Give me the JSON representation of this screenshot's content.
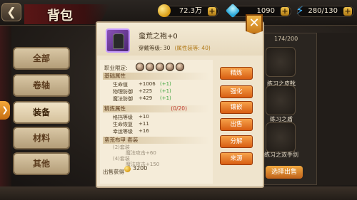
{
  "header": {
    "title": "背包",
    "gold": "72.3万",
    "gems": "1090",
    "energy": "280/130"
  },
  "tabs": [
    "全部",
    "卷轴",
    "装备",
    "材料",
    "其他"
  ],
  "active_tab": "装备",
  "inventory": {
    "count": "174/200",
    "items": [
      "练习之皮靴",
      "练习之盾",
      "练习之双手剑"
    ],
    "filter_button": "选择出售"
  },
  "item": {
    "name": "蛮荒之袍+0",
    "level_label": "穿戴等级: 30",
    "attr_note": "(属性装等: 40)",
    "class_label": "职业限定:",
    "sections": {
      "base": "基础属性",
      "refine": "精炼属性",
      "refine_count": "(0/20)",
      "set": "蛮荒布甲 套装"
    },
    "base_stats": [
      {
        "name": "生命值",
        "value": "+1006",
        "bonus": "(+1)"
      },
      {
        "name": "物理防御",
        "value": "+225",
        "bonus": "(+1)"
      },
      {
        "name": "魔法防御",
        "value": "+429",
        "bonus": "(+1)"
      }
    ],
    "refine_stats": [
      {
        "name": "格挡等级",
        "value": "+10"
      },
      {
        "name": "生命恢复",
        "value": "+11"
      },
      {
        "name": "幸运等级",
        "value": "+16"
      }
    ],
    "set_lines": [
      "(2)套装",
      "魔法攻击+60",
      "(4)套装",
      "魔法攻击+150"
    ],
    "sell_label": "出售获得",
    "sell_value": "3200"
  },
  "actions": [
    "精炼",
    "强化",
    "镶嵌",
    "出售",
    "分解",
    "来源"
  ],
  "colors": {
    "accent_orange": "#e0781e",
    "panel": "#efe4cd",
    "bonus_green": "#3aa33a",
    "refine_red": "#c0392b"
  }
}
